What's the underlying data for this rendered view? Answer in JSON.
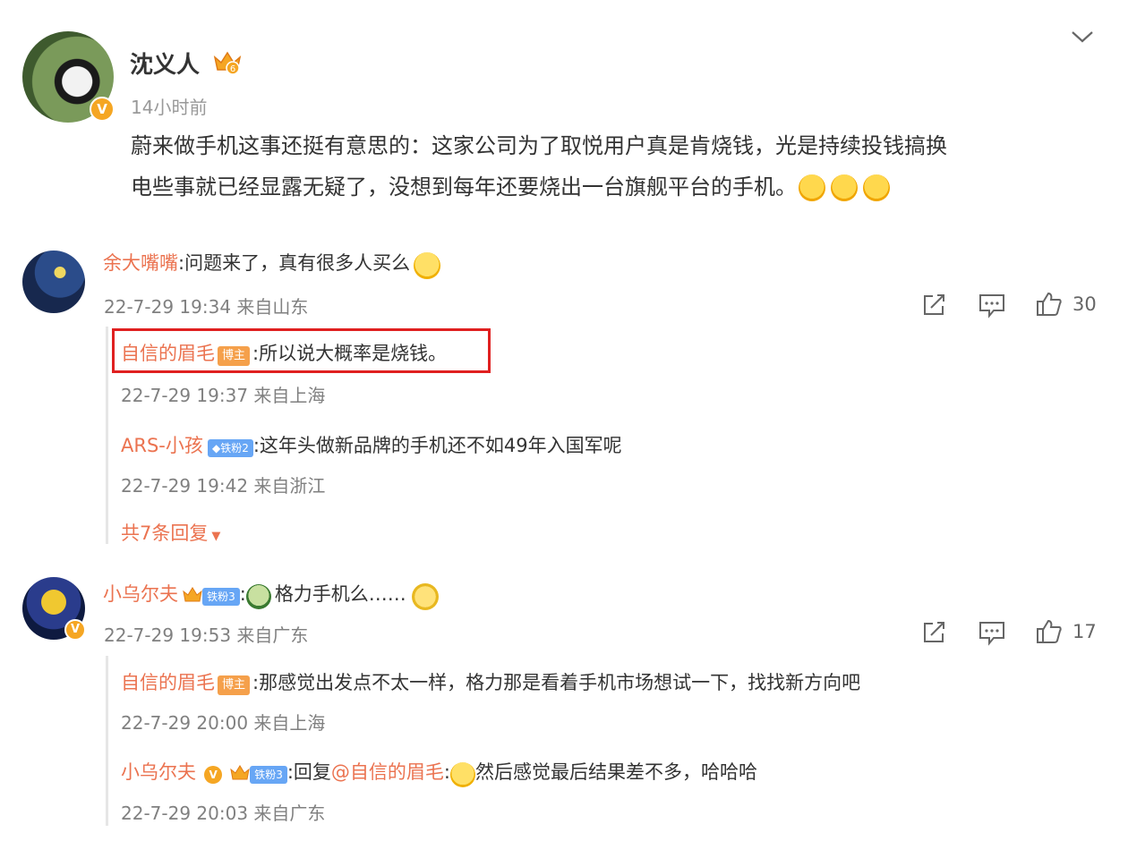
{
  "post": {
    "author": "沈义人",
    "time": "14小时前",
    "text_line1": "蔚来做手机这事还挺有意思的：这家公司为了取悦用户真是肯烧钱，光是持续投钱搞换",
    "text_line2": "电些事就已经显露无疑了，没想到每年还要烧出一台旗舰平台的手机。",
    "badge_level": "6"
  },
  "comments": [
    {
      "user": "余大嘴嘴",
      "text": ":问题来了，真有很多人买么",
      "meta": "22-7-29 19:34 来自山东",
      "likes": "30",
      "replies": [
        {
          "user": "自信的眉毛",
          "tag": "博主",
          "text": ":所以说大概率是烧钱。",
          "meta": "22-7-29 19:37 来自上海"
        },
        {
          "user": "ARS-小孩",
          "fan_tag": "铁粉2",
          "text": ":这年头做新品牌的手机还不如49年入国军呢",
          "meta": "22-7-29 19:42 来自浙江"
        }
      ],
      "more_replies": "共7条回复"
    },
    {
      "user": "小乌尔夫",
      "fan_tag": "铁粉3",
      "text": "格力手机么……",
      "meta": "22-7-29 19:53 来自广东",
      "likes": "17",
      "replies": [
        {
          "user": "自信的眉毛",
          "tag": "博主",
          "text": ":那感觉出发点不太一样，格力那是看着手机市场想试一下，找找新方向吧",
          "meta": "22-7-29 20:00 来自上海"
        },
        {
          "user": "小乌尔夫",
          "fan_tag": "铁粉3",
          "reply_prefix": ":回复",
          "mention": "@自信的眉毛",
          "text": "然后感觉最后结果差不多，哈哈哈",
          "meta": "22-7-29 20:03 来自广东"
        }
      ]
    }
  ],
  "colors": {
    "username": "#eb7350",
    "highlight_box": "#e02020",
    "blogger_tag": "#f5a04b",
    "fan_tag": "#67a6f5"
  },
  "icons": [
    "chevron-down-icon",
    "share-icon",
    "comment-icon",
    "like-icon",
    "verified-icon",
    "crown-icon"
  ]
}
